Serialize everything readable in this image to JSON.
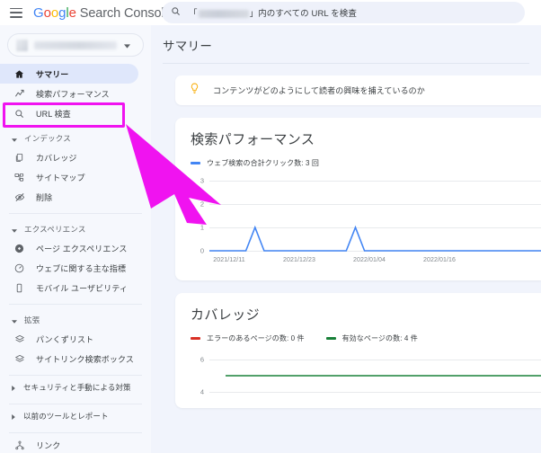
{
  "topbar": {
    "menu_icon": "hamburger-icon",
    "brand": {
      "logo": "Google",
      "product": "Search Console"
    },
    "search": {
      "icon": "search-icon",
      "prefix": "「",
      "suffix": "」内のすべての URL を検査",
      "property_masked": true
    }
  },
  "sidebar": {
    "property_selector": {
      "masked": true,
      "caret_icon": "chevron-down-icon"
    },
    "items": [
      {
        "label": "サマリー",
        "icon": "home-icon",
        "active": true
      },
      {
        "label": "検索パフォーマンス",
        "icon": "trending-up-icon",
        "active": false
      },
      {
        "label": "URL 検査",
        "icon": "search-icon",
        "active": false
      }
    ],
    "groups": [
      {
        "label": "インデックス",
        "caret_icon": "triangle-down-icon",
        "items": [
          {
            "label": "カバレッジ",
            "icon": "document-copy-icon"
          },
          {
            "label": "サイトマップ",
            "icon": "sitemap-icon"
          },
          {
            "label": "削除",
            "icon": "eye-off-icon"
          }
        ]
      },
      {
        "label": "エクスペリエンス",
        "caret_icon": "triangle-down-icon",
        "items": [
          {
            "label": "ページ エクスペリエンス",
            "icon": "target-dot-icon"
          },
          {
            "label": "ウェブに関する主な指標",
            "icon": "speedometer-icon"
          },
          {
            "label": "モバイル ユーザビリティ",
            "icon": "mobile-phone-icon"
          }
        ]
      },
      {
        "label": "拡張",
        "caret_icon": "triangle-down-icon",
        "items": [
          {
            "label": "パンくずリスト",
            "icon": "layers-icon"
          },
          {
            "label": "サイトリンク検索ボックス",
            "icon": "layers-icon"
          }
        ]
      }
    ],
    "collapsed_sections": [
      {
        "label": "セキュリティと手動による対策",
        "caret_icon": "triangle-right-icon"
      },
      {
        "label": "以前のツールとレポート",
        "caret_icon": "triangle-right-icon"
      }
    ],
    "footer_item": {
      "label": "リンク",
      "icon": "links-icon"
    }
  },
  "main": {
    "page_title": "サマリー",
    "tip_card": {
      "icon": "lightbulb-icon",
      "icon_color": "#f9ab00",
      "text": "コンテンツがどのようにして読者の興味を捕えているのか"
    },
    "cards": [
      {
        "title": "検索パフォーマンス"
      },
      {
        "title": "カバレッジ"
      }
    ]
  },
  "annotation": {
    "highlight_color": "#f013f0",
    "arrow_icon": "cursor-arrow-annotation",
    "target": "URL 検査"
  },
  "chart_data": [
    {
      "type": "line",
      "title": "検索パフォーマンス",
      "xlabel": "",
      "ylabel": "",
      "grid": true,
      "legend_position": "top-left",
      "ylim": [
        0,
        3
      ],
      "yticks": [
        0,
        1,
        2,
        3
      ],
      "xticks": [
        "2021/12/11",
        "2021/12/23",
        "2022/01/04",
        "2022/01/16"
      ],
      "series": [
        {
          "name": "ウェブ検索の合計クリック数: 3 回",
          "color": "#4285f4",
          "total_label": "3 回",
          "values": [
            0,
            0,
            0,
            0,
            0,
            1,
            0,
            0,
            0,
            0,
            0,
            0,
            0,
            0,
            0,
            0,
            1,
            0,
            0,
            0,
            0,
            0,
            0,
            0,
            0,
            0,
            0,
            0,
            0,
            0,
            0,
            0,
            0,
            0,
            0,
            0,
            0,
            0,
            0,
            0
          ]
        }
      ]
    },
    {
      "type": "line",
      "title": "カバレッジ",
      "xlabel": "",
      "ylabel": "",
      "grid": true,
      "legend_position": "top-left",
      "ylim": [
        4,
        6
      ],
      "yticks": [
        4,
        6
      ],
      "series": [
        {
          "name": "エラーのあるページの数: 0 件",
          "color": "#d93025",
          "value": 0,
          "values": []
        },
        {
          "name": "有効なページの数: 4 件",
          "color": "#188038",
          "value": 5,
          "values": [
            5,
            5,
            5,
            5,
            5,
            5,
            5,
            5,
            5,
            5
          ]
        }
      ]
    }
  ]
}
